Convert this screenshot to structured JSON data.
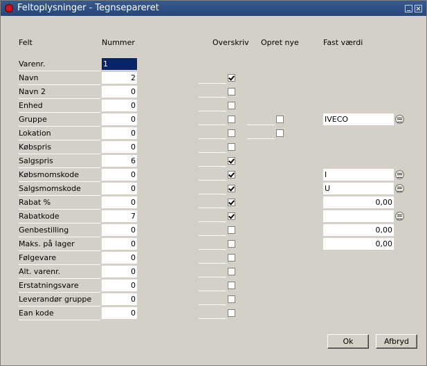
{
  "window": {
    "title": "Feltoplysninger - Tegnsepareret"
  },
  "headers": {
    "felt": "Felt",
    "nummer": "Nummer",
    "overskriv": "Overskriv",
    "opret_nye": "Opret nye",
    "fast_vaerdi": "Fast værdi"
  },
  "rows": [
    {
      "label": "Varenr.",
      "num": "1",
      "overskriv": null
    },
    {
      "label": "Navn",
      "num": "2",
      "overskriv": true
    },
    {
      "label": "Navn 2",
      "num": "0",
      "overskriv": false
    },
    {
      "label": "Enhed",
      "num": "0",
      "overskriv": false
    },
    {
      "label": "Gruppe",
      "num": "0",
      "overskriv": false,
      "opret_nye": false,
      "fast_vaerdi": "IVECO",
      "lookup": true
    },
    {
      "label": "Lokation",
      "num": "0",
      "overskriv": false,
      "opret_nye": false
    },
    {
      "label": "Købspris",
      "num": "0",
      "overskriv": false
    },
    {
      "label": "Salgspris",
      "num": "6",
      "overskriv": true
    },
    {
      "label": "Købsmomskode",
      "num": "0",
      "overskriv": true,
      "fast_vaerdi": "I",
      "lookup": true
    },
    {
      "label": "Salgsmomskode",
      "num": "0",
      "overskriv": true,
      "fast_vaerdi": "U",
      "lookup": true
    },
    {
      "label": "Rabat %",
      "num": "0",
      "overskriv": true,
      "fast_vaerdi": "0,00",
      "align": "right"
    },
    {
      "label": "Rabatkode",
      "num": "7",
      "overskriv": true,
      "fast_vaerdi": "",
      "lookup": true
    },
    {
      "label": "Genbestilling",
      "num": "0",
      "overskriv": false,
      "fast_vaerdi": "0,00",
      "align": "right"
    },
    {
      "label": "Maks. på lager",
      "num": "0",
      "overskriv": false,
      "fast_vaerdi": "0,00",
      "align": "right"
    },
    {
      "label": "Følgevare",
      "num": "0",
      "overskriv": false
    },
    {
      "label": "Alt. varenr.",
      "num": "0",
      "overskriv": false
    },
    {
      "label": "Erstatningsvare",
      "num": "0",
      "overskriv": false
    },
    {
      "label": "Leverandør gruppe",
      "num": "0",
      "overskriv": false
    },
    {
      "label": "Ean kode",
      "num": "0",
      "overskriv": false
    }
  ],
  "buttons": {
    "ok": "Ok",
    "cancel": "Afbryd"
  }
}
